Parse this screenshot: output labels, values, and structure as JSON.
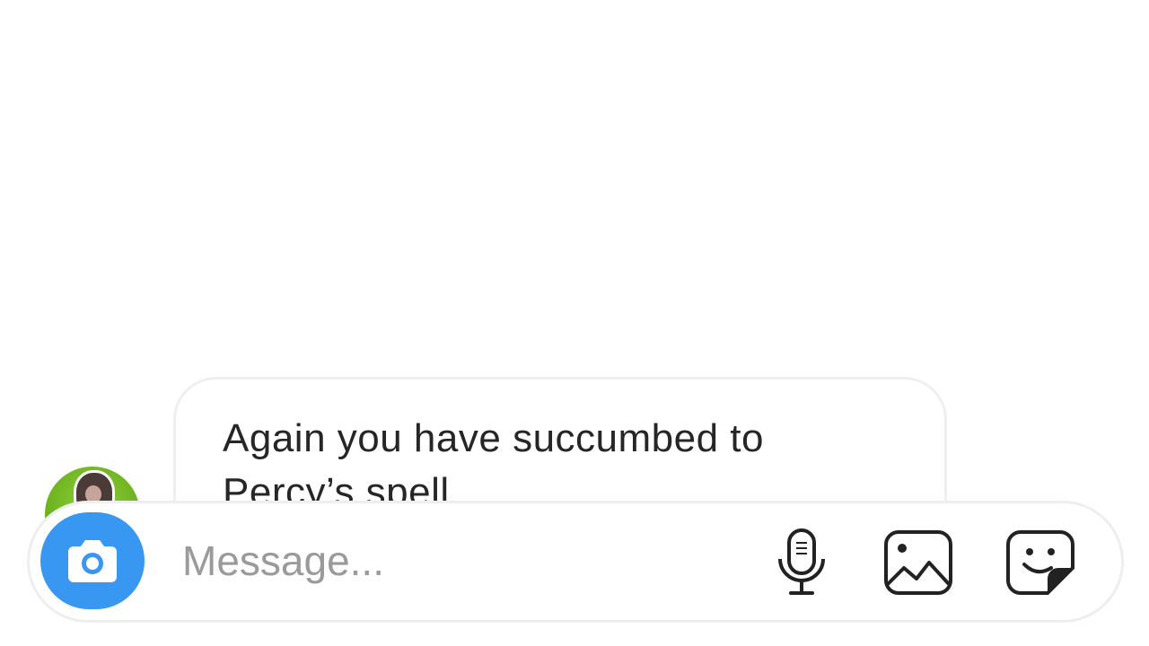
{
  "message_thread": {
    "incoming_message": "Again you have succumbed to Percy’s spell"
  },
  "composer": {
    "placeholder": "Message...",
    "value": "",
    "icons": {
      "camera": "camera-icon",
      "microphone": "microphone-icon",
      "gallery": "gallery-icon",
      "sticker": "sticker-icon"
    }
  },
  "colors": {
    "camera_button": "#3897f0",
    "bubble_border": "#efefef",
    "avatar_background": "#6fb320",
    "placeholder_text": "#9a9a9a",
    "message_text": "#262626"
  }
}
